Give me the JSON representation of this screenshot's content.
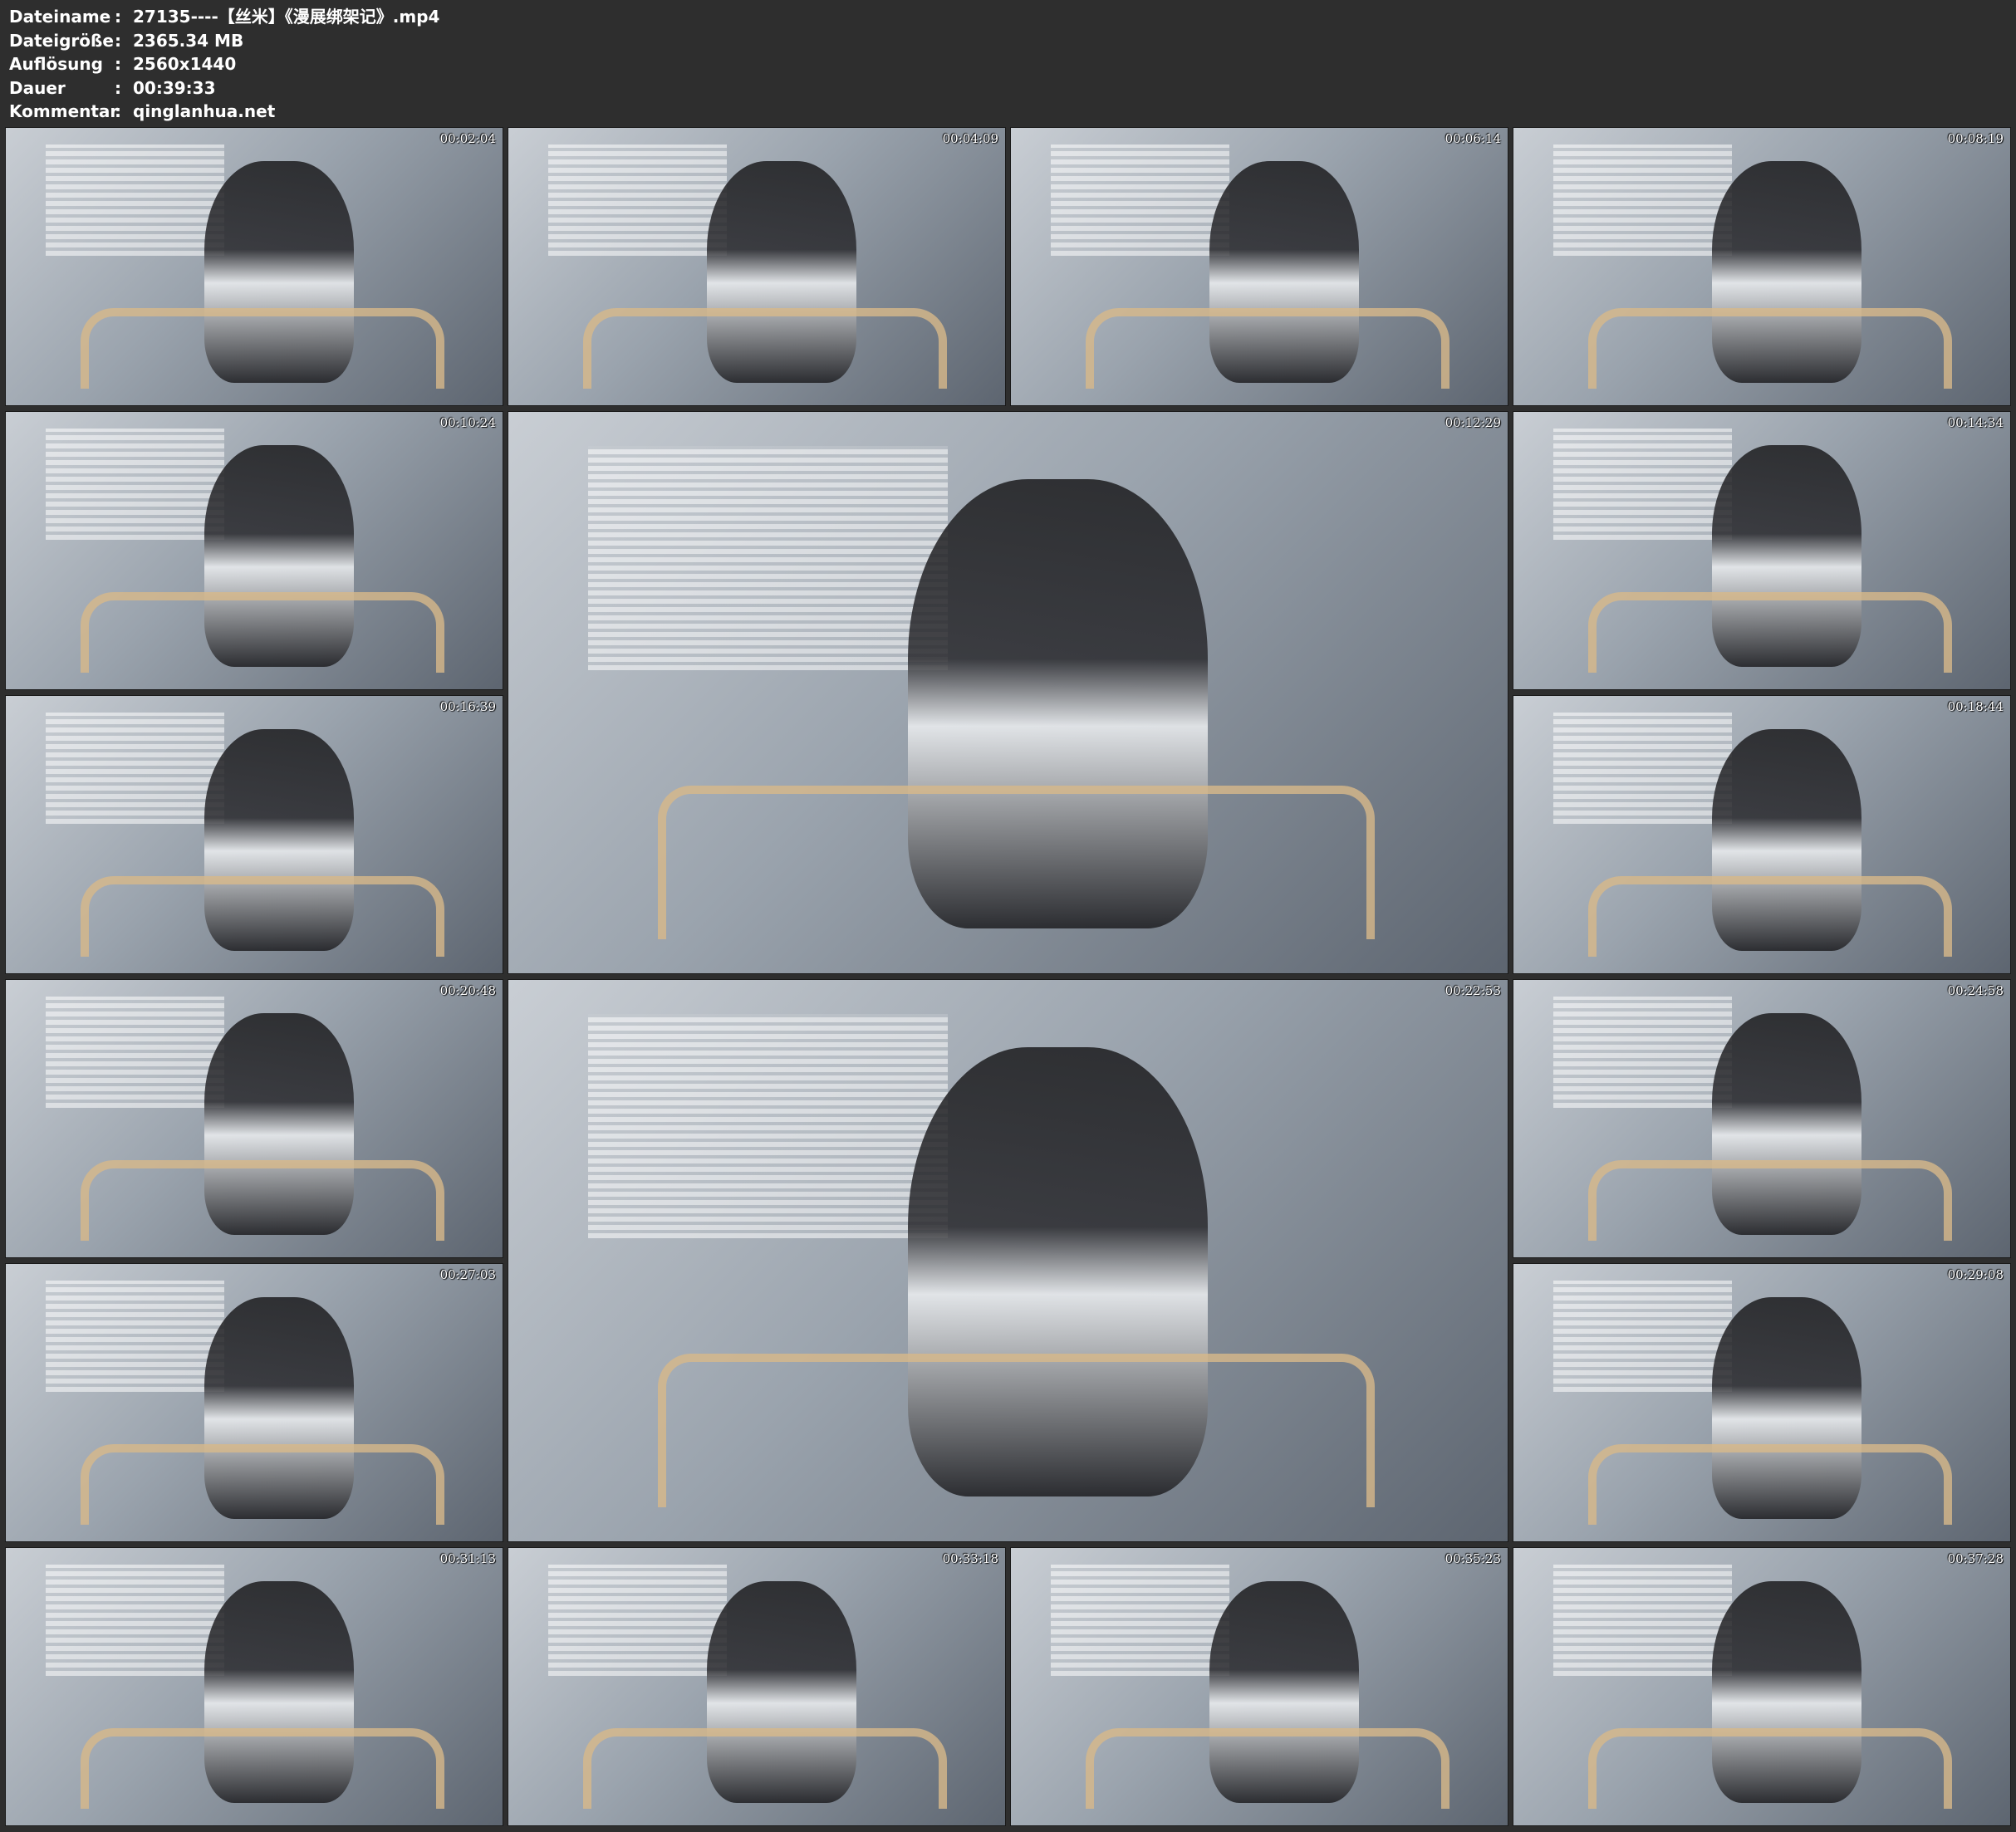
{
  "info": {
    "rows": [
      {
        "label": "Dateiname",
        "sep": ":",
        "value": "27135----【丝米】《漫展绑架记》.mp4"
      },
      {
        "label": "Dateigröße",
        "sep": ":",
        "value": "2365.34 MB"
      },
      {
        "label": "Auflösung",
        "sep": ":",
        "value": "2560x1440"
      },
      {
        "label": "Dauer",
        "sep": ":",
        "value": "00:39:33"
      },
      {
        "label": "Kommentar",
        "sep": ":",
        "value": "qinglanhua.net"
      }
    ]
  },
  "thumbnails": [
    {
      "timestamp": "00:02:04"
    },
    {
      "timestamp": "00:04:09"
    },
    {
      "timestamp": "00:06:14"
    },
    {
      "timestamp": "00:08:19"
    },
    {
      "timestamp": "00:10:24"
    },
    {
      "timestamp": "00:12:29"
    },
    {
      "timestamp": "00:14:34"
    },
    {
      "timestamp": "00:16:39"
    },
    {
      "timestamp": "00:18:44"
    },
    {
      "timestamp": "00:20:48"
    },
    {
      "timestamp": "00:22:53"
    },
    {
      "timestamp": "00:24:58"
    },
    {
      "timestamp": "00:27:03"
    },
    {
      "timestamp": "00:29:08"
    },
    {
      "timestamp": "00:31:13"
    },
    {
      "timestamp": "00:33:18"
    },
    {
      "timestamp": "00:35:23"
    },
    {
      "timestamp": "00:37:28"
    }
  ]
}
